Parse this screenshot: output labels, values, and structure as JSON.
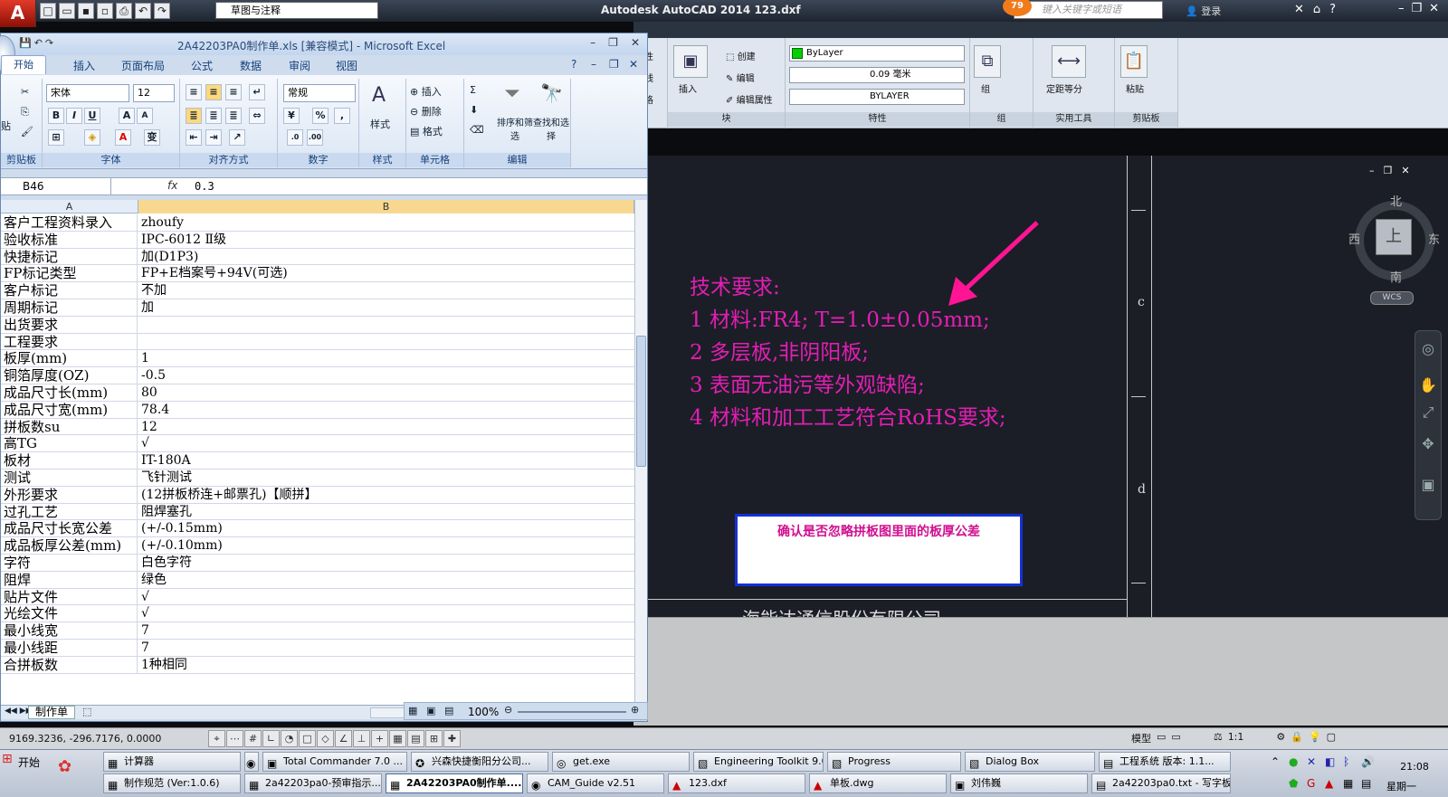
{
  "acad": {
    "logo": "A",
    "workspace": "草图与注释",
    "title": "Autodesk AutoCAD 2014    123.dxf",
    "search_placeholder": "键入关键字或短语",
    "badge_count": "79",
    "login": "登录",
    "ribbon": {
      "block_group": {
        "insert": "插入",
        "create": "创建",
        "edit": "编辑",
        "edit_attr": "编辑属性",
        "label": "块"
      },
      "props_group": {
        "color": "ByLayer",
        "lineweight": "0.09 毫米",
        "linetype": "BYLAYER",
        "label": "特性"
      },
      "group_group": {
        "group": "组",
        "label": "组"
      },
      "util_group": {
        "measure": "定距等分",
        "label": "实用工具"
      },
      "clip_group": {
        "paste": "粘贴",
        "label": "剪贴板"
      },
      "left_partial": [
        "线性",
        "引线",
        "表格"
      ]
    },
    "canvas": {
      "tech_req": [
        "技术要求:",
        "1 材料:FR4; T=1.0±0.05mm;",
        "2 多层板,非阴阳板;",
        "3 表面无油污等外观缺陷;",
        "4 材料和加工工艺符合RoHS要求;"
      ],
      "confirm_note": "确认是否忽略拼板图里面的板厚公差",
      "company_text": "海能达通信股份有限公司",
      "letters": [
        "c",
        "d"
      ],
      "arrow_color": "#ff1493",
      "text_color": "#e21eb4"
    },
    "viewcube": {
      "north": "北",
      "south": "南",
      "east": "东",
      "west": "西",
      "face": "上",
      "wcs": "WCS"
    },
    "status": {
      "coords": "9169.3236, -296.7176, 0.0000",
      "model": "模型",
      "scale": "1:1"
    }
  },
  "excel": {
    "title": "2A42203PA0制作单.xls  [兼容模式] - Microsoft Excel",
    "tabs": [
      "开始",
      "插入",
      "页面布局",
      "公式",
      "数据",
      "审阅",
      "视图"
    ],
    "ribbon": {
      "font_name": "宋体",
      "font_size": "12",
      "number_format": "常规",
      "groups": {
        "clipboard": "剪贴板",
        "font": "字体",
        "align": "对齐方式",
        "number": "数字",
        "style": "样式",
        "cells": "单元格",
        "edit": "编辑"
      },
      "clipboard_partial": "贴",
      "cells_buttons": [
        "插入",
        "删除",
        "格式"
      ],
      "edit_buttons": [
        "排序和筛选",
        "查找和选择"
      ]
    },
    "name_box": "B46",
    "formula_value": "0.3",
    "columns": [
      "A",
      "B"
    ],
    "rows": [
      [
        "客户工程资料录入",
        "zhoufy"
      ],
      [
        "验收标准",
        "IPC-6012 Ⅱ级"
      ],
      [
        "快捷标记",
        "加(D1P3)"
      ],
      [
        "FP标记类型",
        "FP+E档案号+94V(可选)"
      ],
      [
        "客户标记",
        "不加"
      ],
      [
        "周期标记",
        "加"
      ],
      [
        "出货要求",
        ""
      ],
      [
        "工程要求",
        ""
      ],
      [
        "板厚(mm)",
        "1"
      ],
      [
        "铜箔厚度(OZ)",
        "-0.5"
      ],
      [
        "成品尺寸长(mm)",
        "80"
      ],
      [
        "成品尺寸宽(mm)",
        "78.4"
      ],
      [
        "拼板数su",
        "12"
      ],
      [
        "高TG",
        "√"
      ],
      [
        "板材",
        "IT-180A"
      ],
      [
        "测试",
        "飞针测试"
      ],
      [
        "外形要求",
        "(12拼板桥连+邮票孔)【顺拼】"
      ],
      [
        "过孔工艺",
        "阻焊塞孔"
      ],
      [
        "成品尺寸长宽公差",
        "(+/-0.15mm)"
      ],
      [
        "成品板厚公差(mm)",
        "(+/-0.10mm)"
      ],
      [
        "字符",
        "白色字符"
      ],
      [
        "阻焊",
        "绿色"
      ],
      [
        "贴片文件",
        "√"
      ],
      [
        "光绘文件",
        "√"
      ],
      [
        "最小线宽",
        "7"
      ],
      [
        "最小线距",
        "7"
      ],
      [
        "合拼板数",
        "1种相同"
      ]
    ],
    "sheet_tab": "制作单",
    "zoom": "100%"
  },
  "taskbar": {
    "start": "开始",
    "row1": [
      "计算器",
      "Total Commander 7.0 ...",
      "兴森快捷衡阳分公司...",
      "get.exe",
      "Engineering Toolkit 9.0...",
      "Progress",
      "Dialog Box",
      "工程系统  版本: 1.1..."
    ],
    "row2": [
      "制作规范 (Ver:1.0.6)",
      "2a42203pa0-预审指示...",
      "2A42203PA0制作单....",
      "CAM_Guide v2.51",
      "123.dxf",
      "单板.dwg",
      "刘伟巍",
      "2a42203pa0.txt - 写字板"
    ],
    "clock": "21:08",
    "weekday": "星期一"
  }
}
